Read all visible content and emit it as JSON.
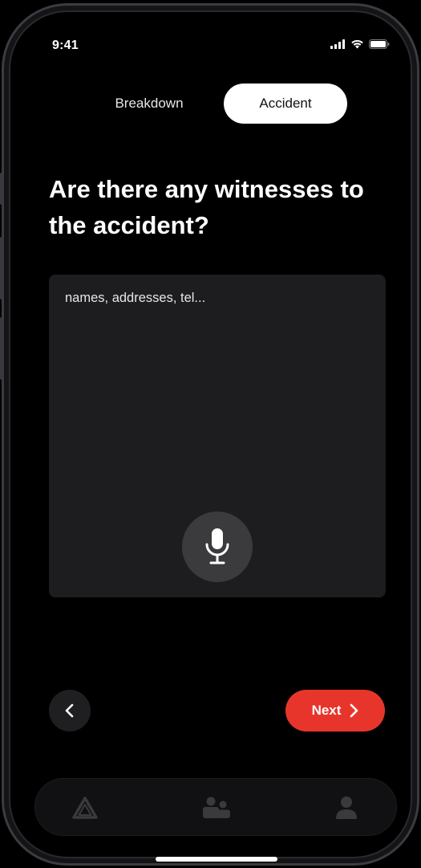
{
  "status": {
    "time": "9:41"
  },
  "segment": {
    "left_label": "Breakdown",
    "right_label": "Accident",
    "selected": "Accident"
  },
  "question": {
    "text": "Are there any witnesses to the accident?"
  },
  "input": {
    "placeholder": "names, addresses, tel...",
    "value": ""
  },
  "actions": {
    "next_label": "Next"
  },
  "tabbar": {
    "items": [
      "triangle-icon",
      "people-icon",
      "person-icon"
    ]
  },
  "colors": {
    "accent": "#e8352b",
    "background": "#000000",
    "surface": "#1d1d1f"
  }
}
